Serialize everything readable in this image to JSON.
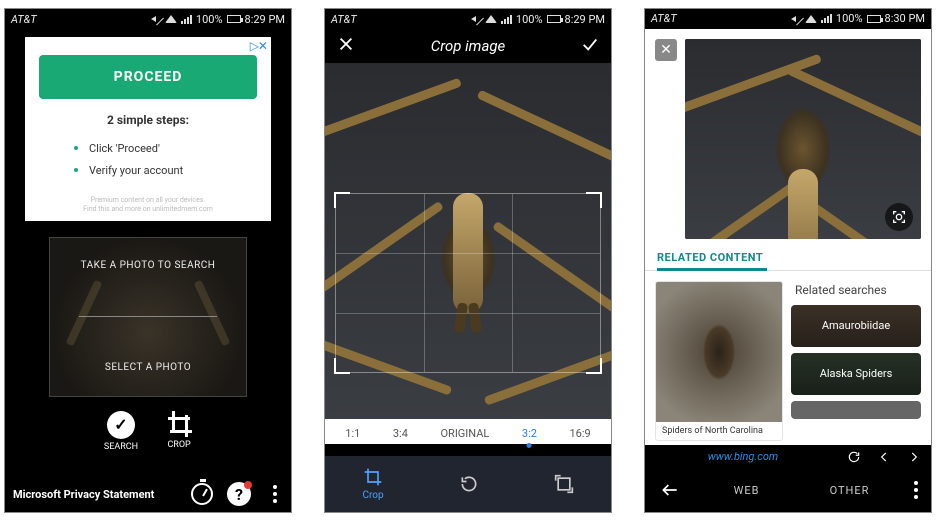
{
  "colors": {
    "accent_green": "#19a974",
    "accent_blue": "#2b7de0",
    "bing_teal": "#0e8a8a",
    "link_blue": "#2b8ee6"
  },
  "screen1": {
    "status": {
      "carrier": "AT&T",
      "battery_pct": "100%",
      "time": "8:29 PM"
    },
    "ad": {
      "close_glyph": "▷✕",
      "cta": "PROCEED",
      "steps_title": "2 simple steps:",
      "steps": [
        "Click 'Proceed'",
        "Verify your account"
      ],
      "fine1": "Premium content on all your devices.",
      "fine2": "Find this and more on unlimitedmem.com"
    },
    "photo_panel": {
      "take": "TAKE A PHOTO TO SEARCH",
      "select": "SELECT A PHOTO"
    },
    "tools": {
      "search": "SEARCH",
      "crop": "CROP"
    },
    "footer": {
      "privacy": "Microsoft Privacy Statement"
    }
  },
  "screen2": {
    "status": {
      "carrier": "AT&T",
      "battery_pct": "100%",
      "time": "8:29 PM"
    },
    "title": "Crop image",
    "ratios": [
      {
        "label": "1:1",
        "active": false
      },
      {
        "label": "3:4",
        "active": false
      },
      {
        "label": "ORIGINAL",
        "active": false
      },
      {
        "label": "3:2",
        "active": true
      },
      {
        "label": "16:9",
        "active": false
      }
    ],
    "tools": {
      "crop": "Crop"
    }
  },
  "screen3": {
    "status": {
      "carrier": "AT&T",
      "battery_pct": "100%",
      "time": "8:30 PM"
    },
    "tab": "RELATED CONTENT",
    "result_caption": "Spiders of North Carolina",
    "related_title": "Related searches",
    "chips": [
      "Amaurobiidae",
      "Alaska Spiders"
    ],
    "url": "www.bing.com",
    "nav": {
      "web": "WEB",
      "other": "OTHER"
    }
  }
}
